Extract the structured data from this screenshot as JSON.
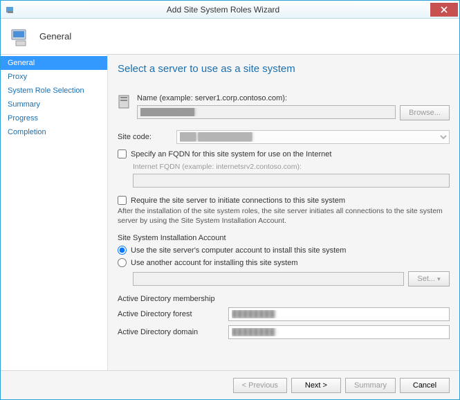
{
  "window": {
    "title": "Add Site System Roles Wizard"
  },
  "header": {
    "title": "General"
  },
  "sidebar": {
    "items": [
      {
        "label": "General",
        "active": true
      },
      {
        "label": "Proxy"
      },
      {
        "label": "System Role Selection"
      },
      {
        "label": "Summary"
      },
      {
        "label": "Progress"
      },
      {
        "label": "Completion"
      }
    ]
  },
  "main": {
    "title": "Select a server to use as a site system",
    "name_label": "Name (example: server1.corp.contoso.com):",
    "name_value": "██████████",
    "browse_label": "Browse...",
    "sitecode_label": "Site code:",
    "sitecode_value": "███ ██████████",
    "fqdn_checkbox": "Specify an FQDN for this site system for use on the Internet",
    "fqdn_hint": "Internet FQDN (example: internetsrv2.contoso.com):",
    "require_checkbox": "Require the site server to initiate connections to this site system",
    "require_desc": "After the  installation of the site system roles, the site server initiates all connections to the site system server by using the Site System Installation Account.",
    "install_section": "Site System Installation Account",
    "radio_computer": "Use the site server's computer account to install this site system",
    "radio_other": "Use another account for installing this site system",
    "set_label": "Set...",
    "ad_section": "Active Directory membership",
    "ad_forest_label": "Active Directory forest",
    "ad_forest_value": "████████",
    "ad_domain_label": "Active Directory domain",
    "ad_domain_value": "████████"
  },
  "footer": {
    "previous": "< Previous",
    "next": "Next >",
    "summary": "Summary",
    "cancel": "Cancel"
  }
}
